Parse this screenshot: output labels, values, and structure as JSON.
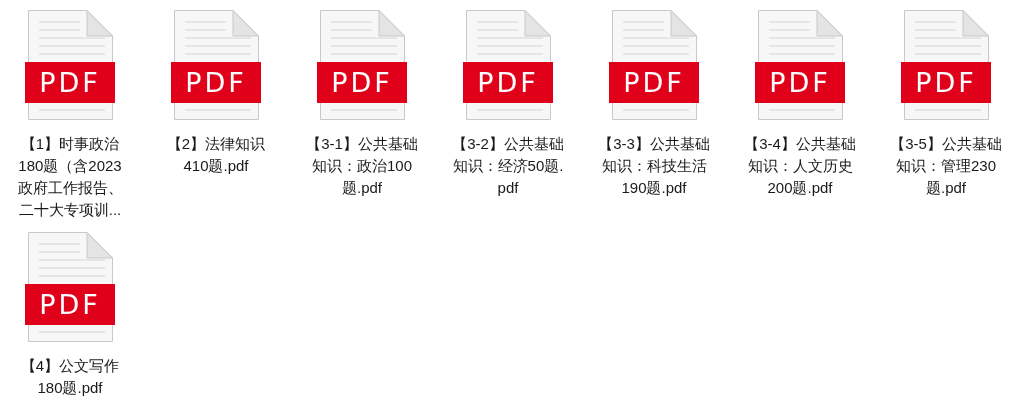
{
  "files": [
    {
      "badge": "PDF",
      "name_lines": [
        "【1】时事政治",
        "180题（含2023",
        "政府工作报告、",
        "二十大专项训..."
      ]
    },
    {
      "badge": "PDF",
      "name_lines": [
        "【2】法律知识",
        "410题.pdf"
      ]
    },
    {
      "badge": "PDF",
      "name_lines": [
        "【3-1】公共基础",
        "知识：政治100",
        "题.pdf"
      ]
    },
    {
      "badge": "PDF",
      "name_lines": [
        "【3-2】公共基础",
        "知识：经济50题.",
        "pdf"
      ]
    },
    {
      "badge": "PDF",
      "name_lines": [
        "【3-3】公共基础",
        "知识：科技生活",
        "190题.pdf"
      ]
    },
    {
      "badge": "PDF",
      "name_lines": [
        "【3-4】公共基础",
        "知识：人文历史",
        "200题.pdf"
      ]
    },
    {
      "badge": "PDF",
      "name_lines": [
        "【3-5】公共基础",
        "知识：管理230",
        "题.pdf"
      ]
    },
    {
      "badge": "PDF",
      "name_lines": [
        "【4】公文写作",
        "180题.pdf"
      ]
    }
  ]
}
